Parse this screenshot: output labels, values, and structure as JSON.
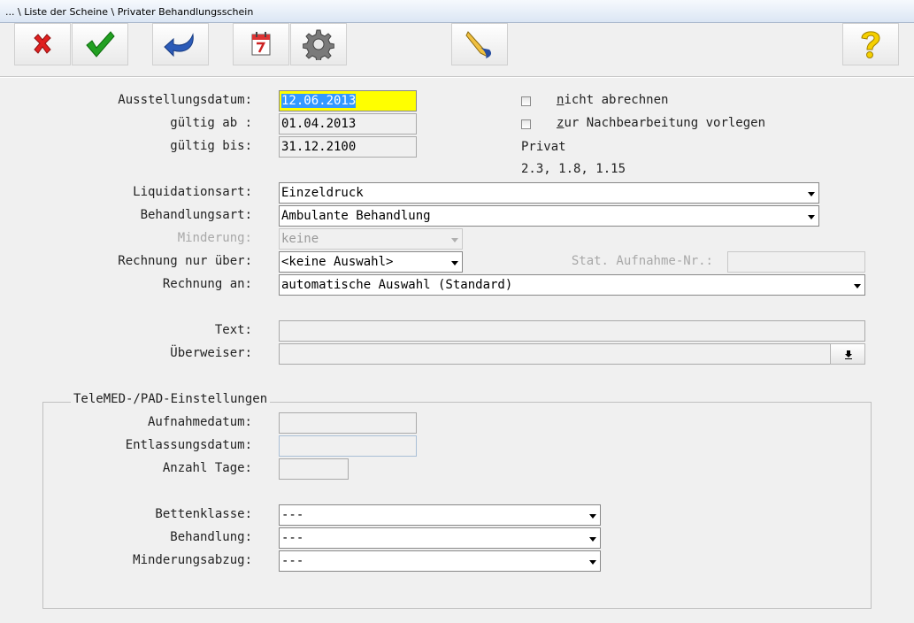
{
  "window": {
    "title": "... \\ Liste der Scheine \\ Privater Behandlungsschein"
  },
  "toolbar": {
    "buttons": [
      {
        "icon": "cancel-x-icon"
      },
      {
        "icon": "ok-check-icon"
      },
      {
        "icon": "undo-arrow-icon"
      },
      {
        "icon": "calendar-icon"
      },
      {
        "icon": "gear-icon"
      },
      {
        "icon": "pen-sign-icon"
      },
      {
        "icon": "help-question-icon"
      }
    ]
  },
  "form": {
    "ausstellungsdatum": {
      "label": "Ausstellungsdatum:",
      "value": "12.06.2013"
    },
    "gueltig_ab": {
      "label": "gültig ab :",
      "value": "01.04.2013"
    },
    "gueltig_bis": {
      "label": "gültig bis:",
      "value": "31.12.2100"
    },
    "nicht_abrechnen": {
      "label_accel": "n",
      "label_rest": "icht abrechnen",
      "checked": false
    },
    "nachbearbeitung": {
      "label_accel": "z",
      "label_rest": "ur Nachbearbeitung vorlegen",
      "checked": false
    },
    "privat_label": "Privat",
    "faktoren": "2.3, 1.8, 1.15",
    "liquidationsart": {
      "label": "Liquidationsart:",
      "value": "Einzeldruck"
    },
    "behandlungsart": {
      "label": "Behandlungsart:",
      "value": "Ambulante Behandlung"
    },
    "minderung": {
      "label": "Minderung:",
      "value": "keine"
    },
    "rechnung_nur_ueber": {
      "label": "Rechnung nur über:",
      "value": "<keine Auswahl>"
    },
    "stat_aufnahme_nr": {
      "label": "Stat. Aufnahme-Nr.:",
      "value": ""
    },
    "rechnung_an": {
      "label": "Rechnung an:",
      "value": "automatische Auswahl (Standard)"
    },
    "text": {
      "label": "Text:",
      "value": ""
    },
    "ueberweiser": {
      "label": "Überweiser:",
      "value": ""
    }
  },
  "telemed": {
    "title": "TeleMED-/PAD-Einstellungen",
    "aufnahmedatum": {
      "label": "Aufnahmedatum:",
      "value": ""
    },
    "entlassungsdatum": {
      "label": "Entlassungsdatum:",
      "value": ""
    },
    "anzahl_tage": {
      "label": "Anzahl Tage:",
      "value": ""
    },
    "bettenklasse": {
      "label": "Bettenklasse:",
      "value": "---"
    },
    "behandlung": {
      "label": "Behandlung:",
      "value": "---"
    },
    "minderungsabzug": {
      "label": "Minderungsabzug:",
      "value": "---"
    }
  }
}
